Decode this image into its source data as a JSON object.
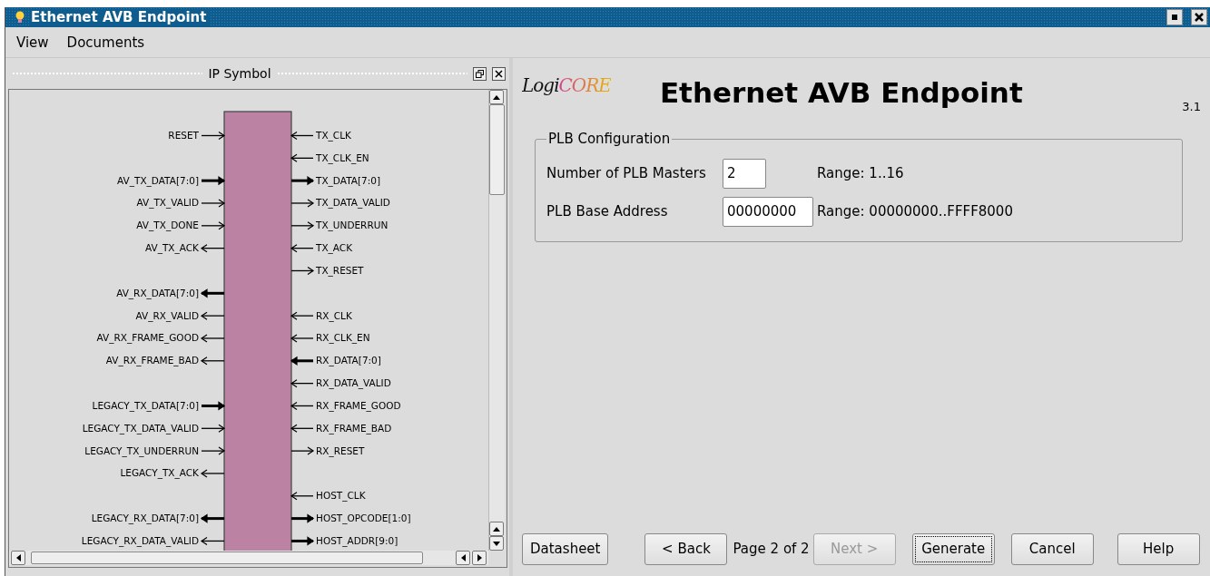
{
  "window": {
    "title": "Ethernet AVB Endpoint"
  },
  "menu": [
    {
      "label": "View"
    },
    {
      "label": "Documents"
    }
  ],
  "symbol_panel": {
    "title": "IP Symbol",
    "rows": [
      {
        "left": {
          "name": "RESET",
          "output": false,
          "bus": false
        },
        "right": {
          "name": "TX_CLK",
          "output": false,
          "bus": false
        }
      },
      {
        "right": {
          "name": "TX_CLK_EN",
          "output": false,
          "bus": false
        }
      },
      {
        "left": {
          "name": "AV_TX_DATA[7:0]",
          "output": false,
          "bus": true
        },
        "right": {
          "name": "TX_DATA[7:0]",
          "output": true,
          "bus": true
        }
      },
      {
        "left": {
          "name": "AV_TX_VALID",
          "output": false,
          "bus": false
        },
        "right": {
          "name": "TX_DATA_VALID",
          "output": true,
          "bus": false
        }
      },
      {
        "left": {
          "name": "AV_TX_DONE",
          "output": false,
          "bus": false
        },
        "right": {
          "name": "TX_UNDERRUN",
          "output": true,
          "bus": false
        }
      },
      {
        "left": {
          "name": "AV_TX_ACK",
          "output": true,
          "bus": false
        },
        "right": {
          "name": "TX_ACK",
          "output": false,
          "bus": false
        }
      },
      {
        "right": {
          "name": "TX_RESET",
          "output": true,
          "bus": false
        }
      },
      {
        "left": {
          "name": "AV_RX_DATA[7:0]",
          "output": true,
          "bus": true
        }
      },
      {
        "left": {
          "name": "AV_RX_VALID",
          "output": true,
          "bus": false
        },
        "right": {
          "name": "RX_CLK",
          "output": false,
          "bus": false
        }
      },
      {
        "left": {
          "name": "AV_RX_FRAME_GOOD",
          "output": true,
          "bus": false
        },
        "right": {
          "name": "RX_CLK_EN",
          "output": false,
          "bus": false
        }
      },
      {
        "left": {
          "name": "AV_RX_FRAME_BAD",
          "output": true,
          "bus": false
        },
        "right": {
          "name": "RX_DATA[7:0]",
          "output": false,
          "bus": true
        }
      },
      {
        "right": {
          "name": "RX_DATA_VALID",
          "output": false,
          "bus": false
        }
      },
      {
        "left": {
          "name": "LEGACY_TX_DATA[7:0]",
          "output": false,
          "bus": true
        },
        "right": {
          "name": "RX_FRAME_GOOD",
          "output": false,
          "bus": false
        }
      },
      {
        "left": {
          "name": "LEGACY_TX_DATA_VALID",
          "output": false,
          "bus": false
        },
        "right": {
          "name": "RX_FRAME_BAD",
          "output": false,
          "bus": false
        }
      },
      {
        "left": {
          "name": "LEGACY_TX_UNDERRUN",
          "output": false,
          "bus": false
        },
        "right": {
          "name": "RX_RESET",
          "output": true,
          "bus": false
        }
      },
      {
        "left": {
          "name": "LEGACY_TX_ACK",
          "output": true,
          "bus": false
        }
      },
      {
        "right": {
          "name": "HOST_CLK",
          "output": false,
          "bus": false
        }
      },
      {
        "left": {
          "name": "LEGACY_RX_DATA[7:0]",
          "output": true,
          "bus": true
        },
        "right": {
          "name": "HOST_OPCODE[1:0]",
          "output": true,
          "bus": true
        }
      },
      {
        "left": {
          "name": "LEGACY_RX_DATA_VALID",
          "output": true,
          "bus": false
        },
        "right": {
          "name": "HOST_ADDR[9:0]",
          "output": true,
          "bus": true
        }
      }
    ]
  },
  "header": {
    "logo": "LogiCORE",
    "title": "Ethernet AVB Endpoint",
    "version": "3.1"
  },
  "config_group": {
    "title": "PLB Configuration",
    "fields": [
      {
        "label": "Number of PLB Masters",
        "value": "2",
        "range": "Range: 1..16"
      },
      {
        "label": "PLB Base Address",
        "value": "00000000",
        "range": "Range: 00000000..FFFF8000"
      }
    ]
  },
  "footer": [
    {
      "kind": "button",
      "label": "Datasheet",
      "disabled": false,
      "focused": false
    },
    {
      "kind": "button",
      "label": "< Back",
      "disabled": false,
      "focused": false
    },
    {
      "kind": "label",
      "label": "Page 2 of 2"
    },
    {
      "kind": "button",
      "label": "Next >",
      "disabled": true,
      "focused": false
    },
    {
      "kind": "button",
      "label": "Generate",
      "disabled": false,
      "focused": true
    },
    {
      "kind": "button",
      "label": "Cancel",
      "disabled": false,
      "focused": false
    },
    {
      "kind": "button",
      "label": "Help",
      "disabled": false,
      "focused": false
    }
  ]
}
